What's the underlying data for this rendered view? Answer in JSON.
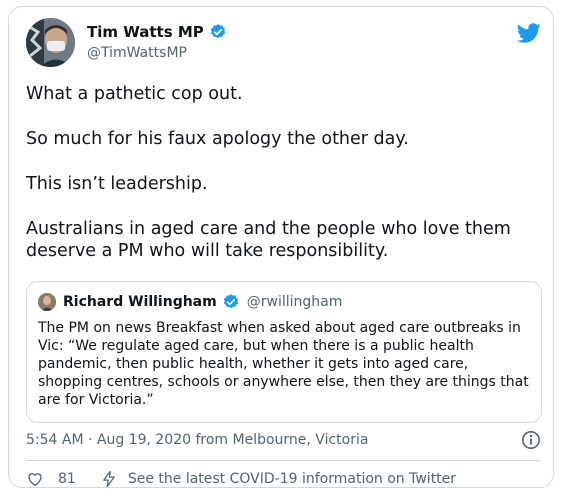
{
  "author": {
    "name": "Tim Watts MP",
    "handle": "@TimWattsMP"
  },
  "tweet": {
    "paragraphs": [
      "What a pathetic cop out.",
      "So much for his faux apology the other day.",
      "This isn’t leadership.",
      "Australians in aged care and the people who love them deserve a PM who will take responsibility."
    ]
  },
  "quoted": {
    "name": "Richard Willingham",
    "handle": "@rwillingham",
    "text": "The PM on news Breakfast when asked about aged care outbreaks in Vic: “We regulate aged care, but when there is a public health pandemic, then public health, whether it gets into aged care, shopping centres, schools or anywhere else, then they are things that are for Victoria.”"
  },
  "meta": {
    "timestamp": "5:54 AM · Aug 19, 2020 from Melbourne, Victoria"
  },
  "footer": {
    "like_count": "81",
    "covid_link": "See the latest COVID-19 information on Twitter"
  },
  "colors": {
    "twitter_blue": "#1d9bf0",
    "secondary_text": "#536471",
    "border": "#cfd9de"
  },
  "icons": [
    "twitter-logo-icon",
    "verified-badge-icon",
    "info-icon",
    "heart-icon",
    "lightning-bolt-icon"
  ]
}
